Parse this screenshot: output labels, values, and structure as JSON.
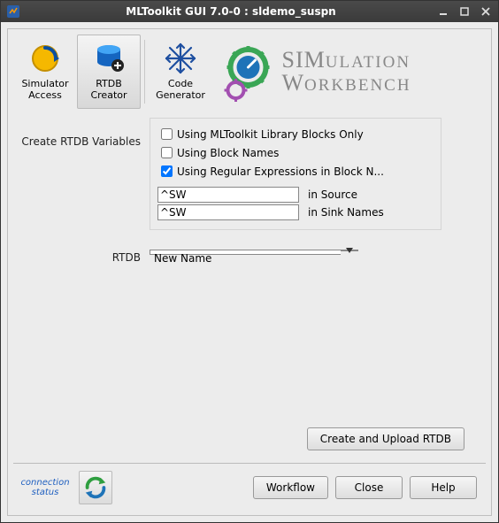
{
  "window": {
    "title": "MLToolkit GUI 7.0-0 : sldemo_suspn"
  },
  "toolbar": {
    "simulator_access": "Simulator\nAccess",
    "rtdb_creator": "RTDB\nCreator",
    "code_generator": "Code\nGenerator"
  },
  "brand": {
    "line1": "SIMULATION",
    "line2": "WORKBENCH"
  },
  "section": {
    "create_rtdb_vars_label": "Create RTDB Variables",
    "opt_lib_only": "Using MLToolkit Library Blocks Only",
    "opt_block_names": "Using Block Names",
    "opt_regex": "Using Regular Expressions in Block N...",
    "regex_source_value": "^SW",
    "regex_source_label": "in Source",
    "regex_sink_value": "^SW",
    "regex_sink_label": "in Sink Names",
    "checked": {
      "lib_only": false,
      "block_names": false,
      "regex": true
    }
  },
  "rtdb": {
    "label": "RTDB",
    "selected": "New Name"
  },
  "buttons": {
    "create_upload": "Create and Upload RTDB",
    "workflow": "Workflow",
    "close": "Close",
    "help": "Help"
  },
  "footer": {
    "connection_status": "connection\nstatus"
  }
}
